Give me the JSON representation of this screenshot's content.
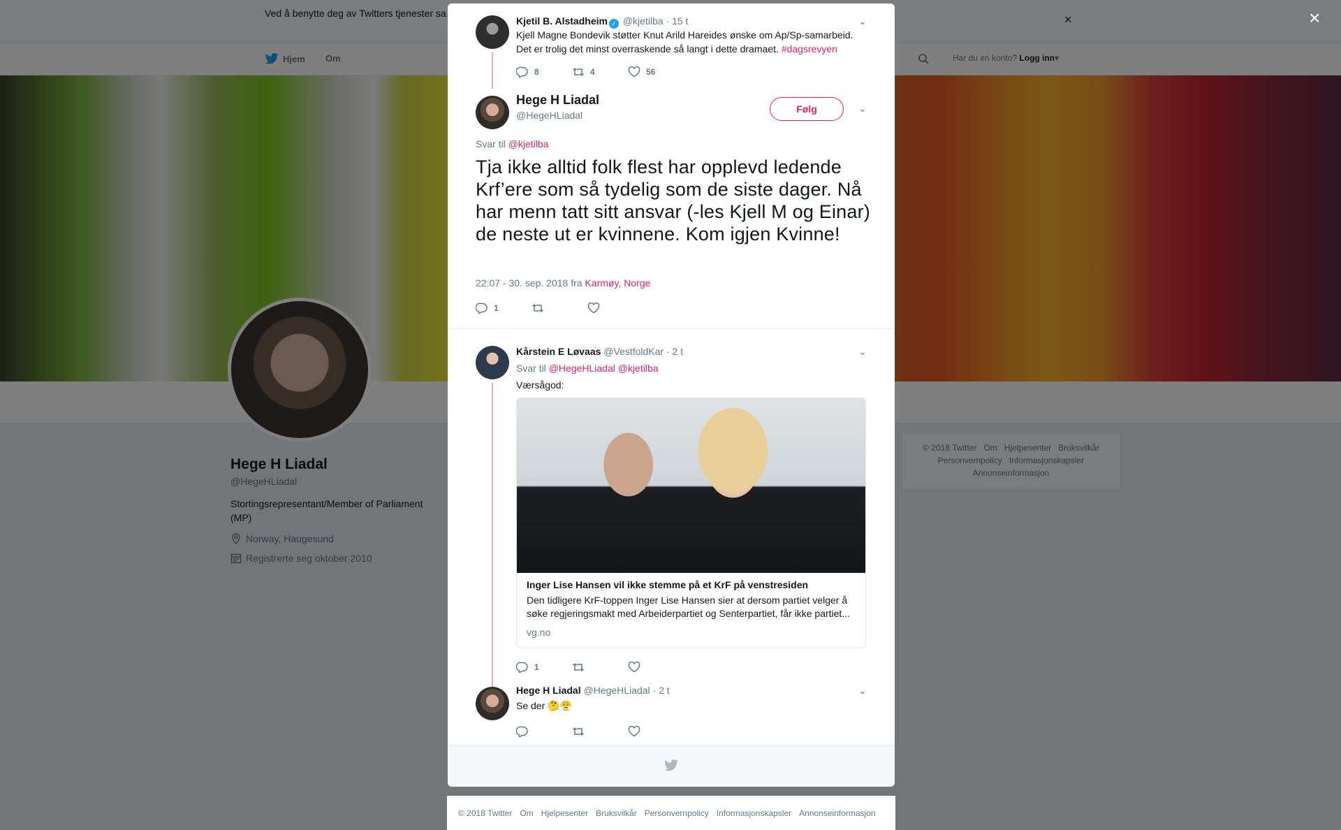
{
  "cookie_bar": {
    "text": "Ved å benytte deg av Twitters tjenester sa… … informasjonskapsler til bl.a. analyser, personalisering og annonser.",
    "close": "×"
  },
  "nav": {
    "home": "Hjem",
    "about": "Om",
    "login_question": "Har du en konto?",
    "login_link": "Logg inn"
  },
  "profile": {
    "name": "Hege H Liadal",
    "handle": "@HegeHLiadal",
    "bio": "Stortingsrepresentant/Member of Parliament (MP)",
    "location": "Norway, Haugesund",
    "joined": "Registrerte seg oktober 2010"
  },
  "side_footer": {
    "links": [
      "© 2018 Twitter",
      "Om",
      "Hjelpesenter",
      "Bruksvilkår",
      "Personvernpolicy",
      "Informasjonskapsler",
      "Annonseinformasjon"
    ]
  },
  "overlay_close": "×",
  "tweets": {
    "parent": {
      "name": "Kjetil B. Alstadheim",
      "handle": "@kjetilba",
      "time": "· 15 t",
      "text": "Kjell Magne Bondevik støtter Knut Arild Hareides ønske om Ap/Sp-samarbeid. Det er trolig det minst overraskende så langt i dette dramaet.",
      "hashtag": "#dagsrevyen",
      "replies": "8",
      "retweets": "4",
      "likes": "56"
    },
    "main": {
      "name": "Hege H Liadal",
      "handle": "@HegeHLiadal",
      "follow": "Følg",
      "reply_to_label": "Svar til",
      "reply_to_user": "@kjetilba",
      "text": "Tja ikke alltid folk flest har opplevd ledende Krf’ere som så tydelig som de siste dager. Nå har menn tatt sitt ansvar (-les Kjell M og Einar) de neste ut er kvinnene. Kom igjen Kvinne!",
      "timestamp": "22:07 - 30. sep. 2018 fra",
      "place": "Karmøy, Norge",
      "replies": "1"
    },
    "reply1": {
      "name": "Kårstein E Løvaas",
      "handle": "@VestfoldKar",
      "time": "· 2 t",
      "reply_to_label": "Svar til",
      "reply_to_users": "@HegeHLiadal @kjetilba",
      "text": "Værsågod:",
      "card_title": "Inger Lise Hansen vil ikke stemme på et KrF på venstresiden",
      "card_desc": "Den tidligere KrF-toppen Inger Lise Hansen sier at dersom partiet velger å søke regjeringsmakt med Arbeiderpartiet og Senterpartiet, får ikke partiet...",
      "card_domain": "vg.no",
      "replies": "1"
    },
    "reply2": {
      "name": "Hege H Liadal",
      "handle": "@HegeHLiadal",
      "time": "· 2 t",
      "text": "Se der 🤔😤"
    }
  },
  "bottom_footer": {
    "links": [
      "© 2018 Twitter",
      "Om",
      "Hjelpesenter",
      "Bruksvilkår",
      "Personvernpolicy",
      "Informasjonskapsler",
      "Annonseinformasjon"
    ]
  },
  "colors": {
    "accent": "#e0245e",
    "secondary_text": "#657786",
    "verified": "#1da1f2",
    "thread_line": "#f4a9b0"
  },
  "icons": [
    "twitter-bird-icon",
    "search-icon",
    "location-icon",
    "calendar-icon",
    "reply-icon",
    "retweet-icon",
    "like-icon",
    "chevron-down-icon",
    "close-icon",
    "verified-icon"
  ]
}
